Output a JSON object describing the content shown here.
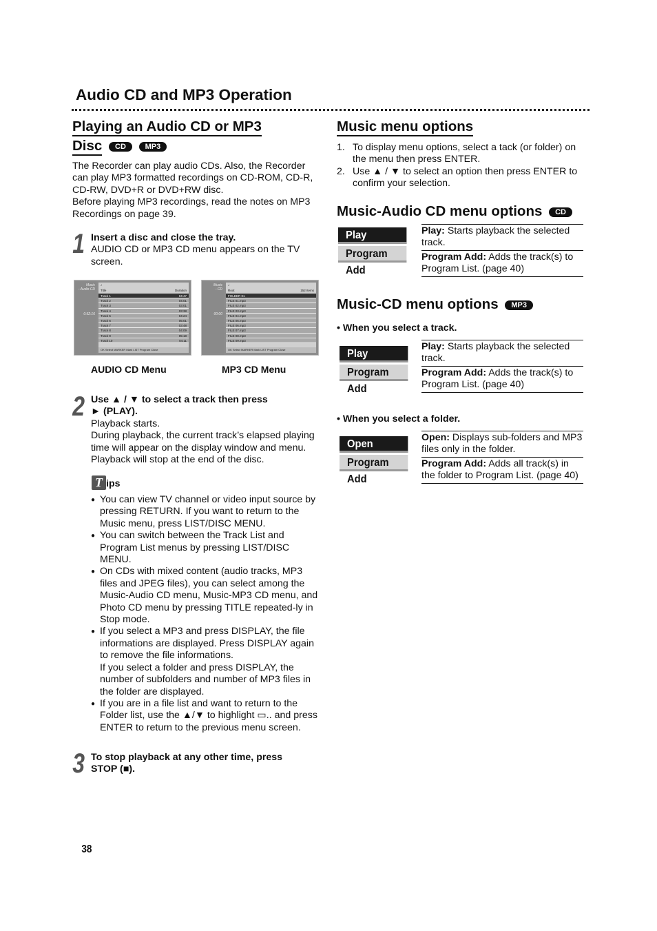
{
  "page_title": "Audio CD and MP3 Operation",
  "left": {
    "heading_line1": "Playing an Audio CD or MP3",
    "heading_line2": "Disc",
    "badges": [
      "CD",
      "MP3"
    ],
    "intro": [
      "The Recorder can play audio CDs. Also, the Recorder can play MP3 formatted recordings on CD-ROM, CD-R, CD-RW, DVD+R or DVD+RW disc.",
      "Before playing MP3 recordings, read the notes on MP3 Recordings on page 39."
    ],
    "step1": {
      "num": "1",
      "title": "Insert a disc and close the tray.",
      "text": "AUDIO CD or MP3 CD menu appears on the TV screen."
    },
    "audio_menu": {
      "caption": "AUDIO CD Menu",
      "side": "Music",
      "side2": "- Audio CD",
      "time": "0:52:16",
      "col_title": "Title",
      "col_dur": "Duration",
      "rows": [
        [
          "Track 1",
          "04:47"
        ],
        [
          "Track 2",
          "04:01"
        ],
        [
          "Track 3",
          "03:01"
        ],
        [
          "Track 4",
          "03:38"
        ],
        [
          "Track 5",
          "04:24"
        ],
        [
          "Track 6",
          "05:01"
        ],
        [
          "Track 7",
          "03:48"
        ],
        [
          "Track 8",
          "04:09"
        ],
        [
          "Track 9",
          "05:18"
        ],
        [
          "Track 10",
          "04:11"
        ]
      ],
      "footer": "OK Select  MARKER Mark  LIST Program  Close"
    },
    "mp3_menu": {
      "caption": "MP3 CD Menu",
      "side": "Music",
      "side2": "- CD",
      "time": "00:00",
      "col_title": "Root",
      "col_dur": "152 Items",
      "rows": [
        [
          "FOLDER 01",
          ""
        ],
        [
          "FILE 01.mp3",
          ""
        ],
        [
          "FILE 02.mp3",
          ""
        ],
        [
          "FILE 03.mp3",
          ""
        ],
        [
          "FILE 04.mp3",
          ""
        ],
        [
          "FILE 05.mp3",
          ""
        ],
        [
          "FILE 06.mp3",
          ""
        ],
        [
          "FILE 07.mp3",
          ""
        ],
        [
          "FILE 08.mp3",
          ""
        ],
        [
          "FILE 09.mp3",
          ""
        ]
      ],
      "footer": "OK Select  MARKER Mark  LIST Program  Close"
    },
    "step2": {
      "num": "2",
      "title1": "Use ▲ / ▼ to select a track then press",
      "title2": "► (PLAY).",
      "text": [
        "Playback starts.",
        "During playback, the current track’s elapsed playing time will appear on the display window and menu.",
        "Playback will stop at the end of the disc."
      ]
    },
    "tips": {
      "icon_letter": "T",
      "label": "ips",
      "items": [
        "You can view TV channel or video input source by pressing RETURN. If you want to return to the Music menu, press LIST/DISC MENU.",
        "You can switch between the Track List and Program List menus by pressing LIST/DISC MENU.",
        "On CDs with mixed content (audio tracks, MP3 files and JPEG files), you can select among the Music-Audio CD menu, Music-MP3 CD menu, and Photo CD menu by pressing TITLE repeated-ly in Stop mode.",
        "If you select a MP3 and press DISPLAY, the file informations are displayed. Press DISPLAY again to remove the file informations.",
        "If you select a folder and press DISPLAY, the number of subfolders and number of MP3 files in the folder are displayed.",
        "If you are in a file list and want to return to the Folder list, use the ▲/▼ to highlight ▭.. and press ENTER to return to the previous menu screen."
      ]
    },
    "step3": {
      "num": "3",
      "title": "To stop playback at any other time, press STOP (■)."
    }
  },
  "right": {
    "music_menu": {
      "heading": "Music menu options",
      "items": [
        "To display menu options, select a tack (or folder) on the menu then press ENTER.",
        "Use ▲ / ▼ to select an option then press ENTER to confirm your selection."
      ]
    },
    "audio_cd": {
      "heading": "Music-Audio CD menu options",
      "badge": "CD",
      "buttons": [
        "Play",
        "Program Add"
      ],
      "desc": [
        {
          "term": "Play:",
          "text": " Starts playback the selected track."
        },
        {
          "term": "Program Add:",
          "text": " Adds the track(s) to Program List. (page 40)"
        }
      ]
    },
    "mp3_cd": {
      "heading": "Music-CD menu options",
      "badge": "MP3",
      "track_label": "•  When you select a track.",
      "track_buttons": [
        "Play",
        "Program Add"
      ],
      "track_desc": [
        {
          "term": "Play:",
          "text": " Starts playback the selected track."
        },
        {
          "term": "Program Add:",
          "text": " Adds the track(s) to Program List. (page 40)"
        }
      ],
      "folder_label": "•  When you select a folder.",
      "folder_buttons": [
        "Open",
        "Program Add"
      ],
      "folder_desc": [
        {
          "term": "Open:",
          "text": " Displays sub-folders and MP3 files only in the folder."
        },
        {
          "term": "Program Add:",
          "text": " Adds all track(s) in the folder to Program List. (page 40)"
        }
      ]
    }
  },
  "page_number": "38"
}
